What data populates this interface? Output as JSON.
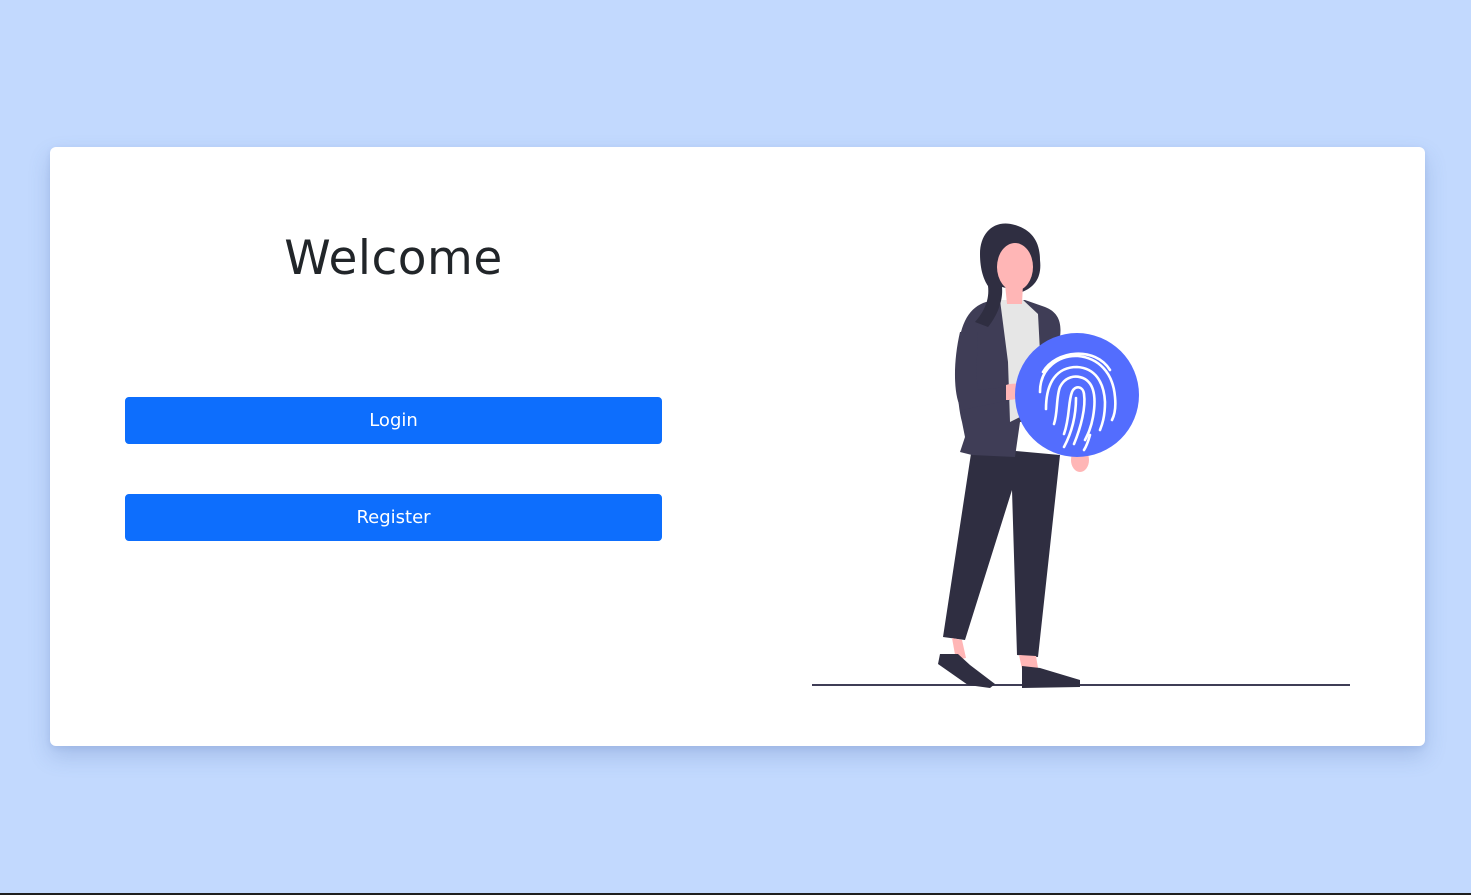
{
  "welcome": {
    "title": "Welcome"
  },
  "buttons": {
    "login_label": "Login",
    "register_label": "Register"
  },
  "illustration": {
    "icon": "fingerprint-icon"
  },
  "colors": {
    "page_background": "#c2d9fe",
    "card_background": "#ffffff",
    "primary_button": "#0d6efd",
    "title_text": "#212529",
    "fingerprint_circle": "#536dfe"
  }
}
